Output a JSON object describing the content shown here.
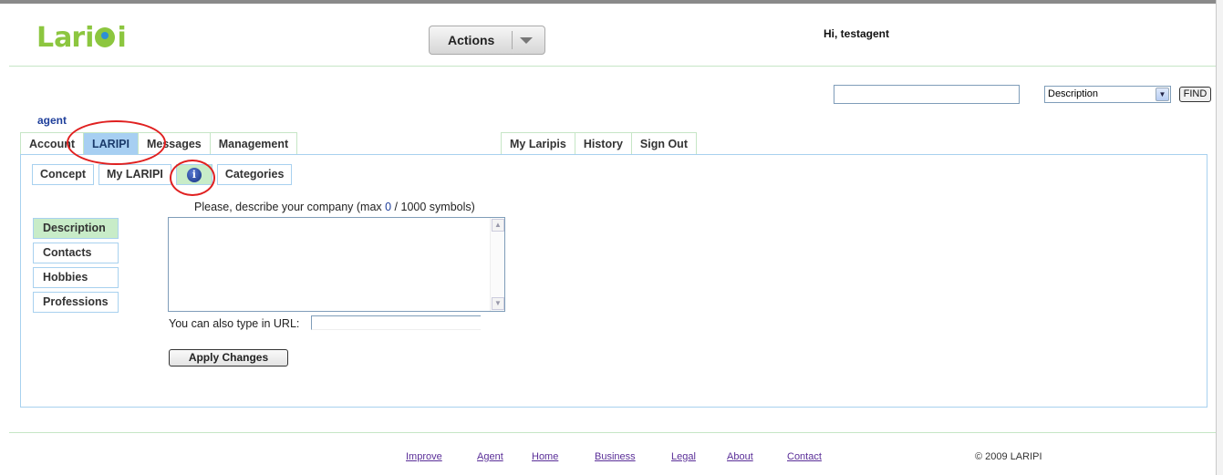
{
  "header": {
    "logo_text": "Laripi",
    "actions_label": "Actions",
    "greeting": "Hi, testagent"
  },
  "search": {
    "input_value": "",
    "select_value": "Description",
    "find_label": "FIND"
  },
  "user_label": "agent",
  "tabs_left": [
    {
      "label": "Account"
    },
    {
      "label": "LARIPI"
    },
    {
      "label": "Messages"
    },
    {
      "label": "Management"
    }
  ],
  "tabs_right": [
    {
      "label": "My Laripis"
    },
    {
      "label": "History"
    },
    {
      "label": "Sign Out"
    }
  ],
  "subtabs": {
    "concept": "Concept",
    "my_laripi": "My LARIPI",
    "info_icon": "info-icon",
    "categories": "Categories"
  },
  "side_menu": [
    {
      "label": "Description"
    },
    {
      "label": "Contacts"
    },
    {
      "label": "Hobbies"
    },
    {
      "label": "Professions"
    }
  ],
  "form": {
    "describe_prefix": "Please, describe your company (max ",
    "describe_count": "0",
    "describe_suffix": " / 1000 symbols)",
    "textarea_value": "",
    "url_label": "You can also type in URL:",
    "url_value": "",
    "apply_label": "Apply Changes"
  },
  "footer": {
    "links": [
      {
        "label": "Improve"
      },
      {
        "label": "Agent"
      },
      {
        "label": "Home"
      },
      {
        "label": "Business"
      },
      {
        "label": "Legal"
      },
      {
        "label": "About"
      },
      {
        "label": "Contact"
      }
    ],
    "copyright": "© 2009 LARIPI"
  },
  "colors": {
    "active_tab": "#a7cff2",
    "active_subtab": "#c8ecc8",
    "annotation_ring": "#e02020",
    "link": "#5a2e98"
  }
}
